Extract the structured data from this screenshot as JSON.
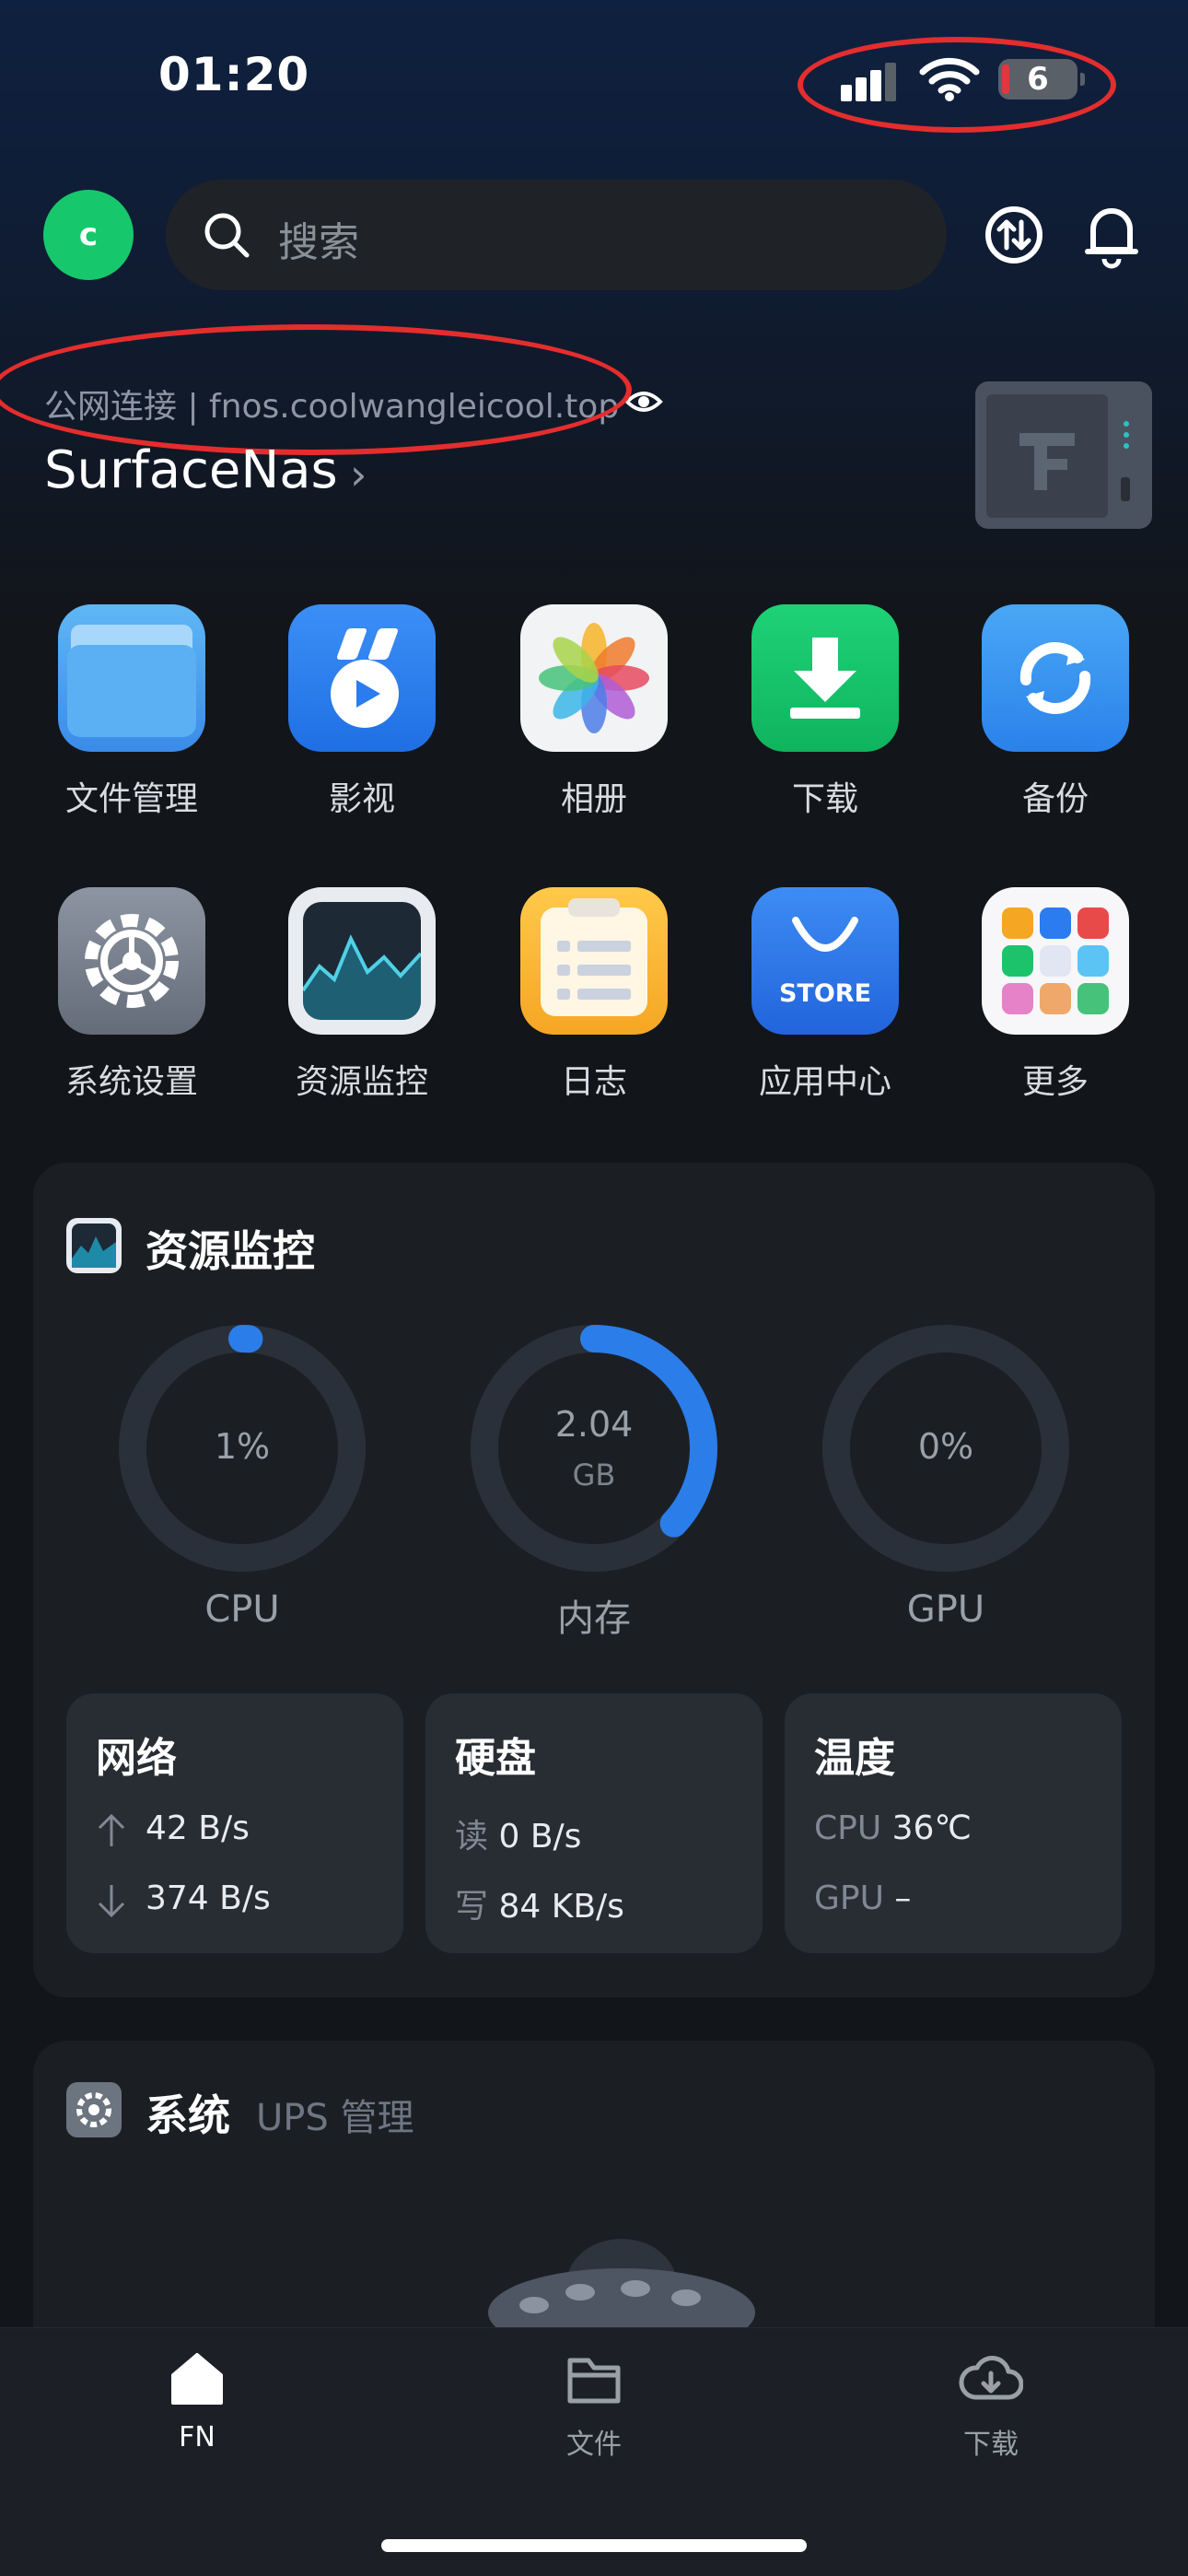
{
  "status_bar": {
    "time": "01:20",
    "battery": "6"
  },
  "header": {
    "avatar_letter": "c",
    "search_placeholder": "搜索"
  },
  "server": {
    "connection": "公网连接 | fnos.coolwangleicool.top",
    "name": "SurfaceNas",
    "chevron": "›"
  },
  "apps": [
    {
      "label": "文件管理",
      "icon": "folder-icon"
    },
    {
      "label": "影视",
      "icon": "video-icon"
    },
    {
      "label": "相册",
      "icon": "photos-icon"
    },
    {
      "label": "下载",
      "icon": "download-icon"
    },
    {
      "label": "备份",
      "icon": "backup-icon"
    },
    {
      "label": "系统设置",
      "icon": "settings-gear-icon"
    },
    {
      "label": "资源监控",
      "icon": "monitor-chart-icon"
    },
    {
      "label": "日志",
      "icon": "log-icon"
    },
    {
      "label": "应用中心",
      "icon": "store-bag-icon",
      "text": "STORE"
    },
    {
      "label": "更多",
      "icon": "more-grid-icon"
    }
  ],
  "resource": {
    "title": "资源监控",
    "cpu": {
      "value": "1%",
      "label": "CPU",
      "fraction": 0.01
    },
    "memory": {
      "value": "2.04",
      "unit": "GB",
      "label": "内存",
      "fraction": 0.37
    },
    "gpu": {
      "value": "0%",
      "label": "GPU",
      "fraction": 0
    },
    "network": {
      "title": "网络",
      "up": "42 B/s",
      "down": "374 B/s"
    },
    "disk": {
      "title": "硬盘",
      "read_label": "读",
      "read": "0 B/s",
      "write_label": "写",
      "write": "84 KB/s"
    },
    "temp": {
      "title": "温度",
      "cpu_label": "CPU",
      "cpu": "36℃",
      "gpu_label": "GPU",
      "gpu": "–"
    }
  },
  "system": {
    "title": "系统",
    "subtitle": "UPS 管理"
  },
  "tabs": [
    {
      "label": "FN",
      "icon": "home-icon",
      "active": true
    },
    {
      "label": "文件",
      "icon": "folder-outline-icon"
    },
    {
      "label": "下载",
      "icon": "cloud-download-icon"
    }
  ],
  "colors": {
    "accent": "#2b7de9",
    "green": "#16c86b",
    "annotation_red": "#e52d2d"
  }
}
